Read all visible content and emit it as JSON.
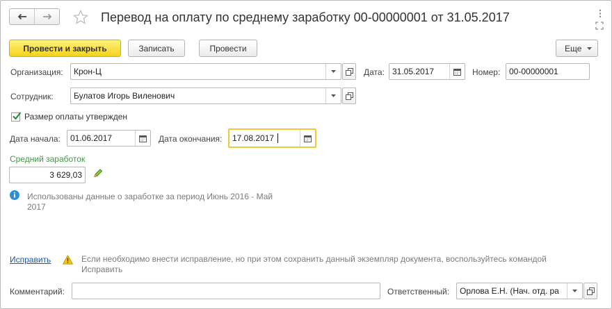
{
  "window": {
    "title": "Перевод на оплату по среднему заработку 00-00000001 от 31.05.2017"
  },
  "toolbar": {
    "post_and_close": "Провести и закрыть",
    "save": "Записать",
    "post": "Провести",
    "more": "Еще"
  },
  "form": {
    "organization_label": "Организация:",
    "organization_value": "Крон-Ц",
    "date_label": "Дата:",
    "date_value": "31.05.2017",
    "number_label": "Номер:",
    "number_value": "00-00000001",
    "employee_label": "Сотрудник:",
    "employee_value": "Булатов Игорь Виленович",
    "approved_label": "Размер оплаты утвержден",
    "approved_checked": true,
    "start_label": "Дата начала:",
    "start_value": "01.06.2017",
    "end_label": "Дата окончания:",
    "end_value": "17.08.2017",
    "avg_label": "Средний заработок",
    "avg_value": "3 629,03",
    "info_text_line1": "Использованы данные о заработке за период Июнь 2016 - Май",
    "info_text_line2": "2017"
  },
  "footer": {
    "correct_link": "Исправить",
    "warning_line1": "Если необходимо внести исправление, но при этом сохранить данный экземпляр документа, воспользуйтесь командой",
    "warning_line2": "Исправить",
    "comment_label": "Комментарий:",
    "comment_value": "",
    "responsible_label": "Ответственный:",
    "responsible_value": "Орлова Е.Н. (Нач. отд. ра"
  },
  "colors": {
    "primary_button": "#f5d21d",
    "focus_border": "#f0c93a",
    "green_text": "#3d9a46",
    "link": "#1c56a8",
    "info_icon": "#2f8fd0",
    "warning_icon": "#f2c418"
  },
  "icons": {
    "back": "arrow-left-icon",
    "forward": "arrow-right-icon",
    "favorite": "star-icon",
    "menu": "kebab-icon",
    "maximize": "maximize-icon",
    "close": "close-icon",
    "calendar": "calendar-icon",
    "dropdown": "chevron-down-icon",
    "open": "open-icon",
    "edit": "pencil-icon",
    "info": "info-icon",
    "warning": "warning-icon"
  }
}
